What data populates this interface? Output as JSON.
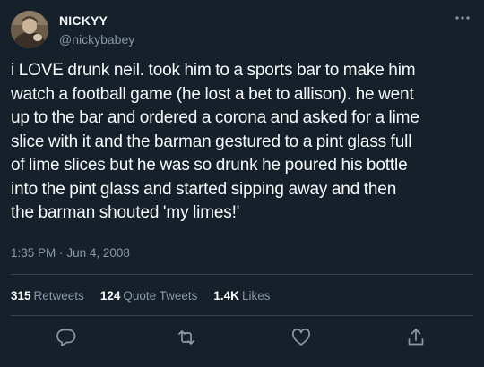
{
  "author": {
    "display_name": "NICKYY",
    "handle": "@nickybabey"
  },
  "tweet": {
    "lines": [
      "i LOVE drunk neil. took him to a sports bar to make him",
      "watch a football game (he lost a bet to allison). he went",
      "up to the bar and ordered a corona and asked for a lime",
      "slice with it and the barman gestured to a pint glass full",
      "of lime slices but he was so drunk he poured his bottle",
      "into the pint glass and started sipping away and then",
      "the barman shouted 'my limes!'"
    ],
    "time": "1:35 PM",
    "separator": "·",
    "date": "Jun 4, 2008"
  },
  "stats": {
    "retweets": {
      "count": "315",
      "label": "Retweets"
    },
    "quote_tweets": {
      "count": "124",
      "label": "Quote Tweets"
    },
    "likes": {
      "count": "1.4K",
      "label": "Likes"
    }
  },
  "icons": {
    "more": "more-horizontal-icon",
    "reply": "reply-icon",
    "retweet": "retweet-icon",
    "like": "heart-icon",
    "share": "share-icon"
  },
  "colors": {
    "background": "#15202b",
    "text": "#f7f9f9",
    "secondary_text": "#8b98a5",
    "divider": "#38444d"
  }
}
